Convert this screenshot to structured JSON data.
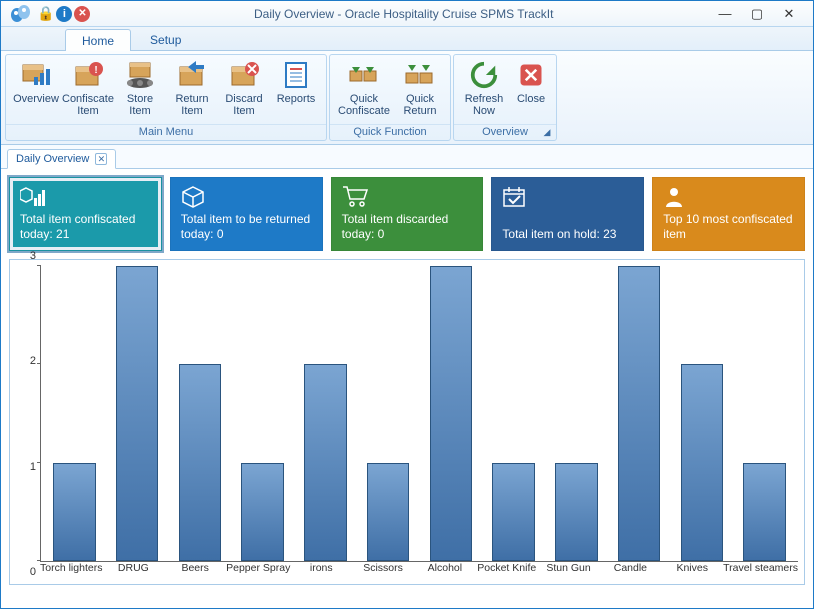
{
  "window": {
    "title": "Daily Overview - Oracle Hospitality Cruise SPMS TrackIt"
  },
  "tabs": {
    "home": "Home",
    "setup": "Setup"
  },
  "ribbon": {
    "main_menu": {
      "label": "Main Menu",
      "overview": "Overview",
      "confiscate_item": "Confiscate\nItem",
      "store_item": "Store\nItem",
      "return_item": "Return\nItem",
      "discard_item": "Discard\nItem",
      "reports": "Reports"
    },
    "quick_function": {
      "label": "Quick Function",
      "quick_confiscate": "Quick\nConfiscate",
      "quick_return": "Quick\nReturn"
    },
    "overview": {
      "label": "Overview",
      "refresh_now": "Refresh\nNow",
      "close": "Close"
    }
  },
  "doc_tab": {
    "label": "Daily Overview"
  },
  "tiles": {
    "confiscated": "Total item confiscated today: 21",
    "to_return": "Total item to be returned today: 0",
    "discarded": "Total item discarded today: 0",
    "on_hold": "Total item on hold: 23",
    "top10": "Top 10 most confiscated item"
  },
  "chart_data": {
    "type": "bar",
    "title": "",
    "xlabel": "",
    "ylabel": "",
    "ylim": [
      0,
      3
    ],
    "yticks": [
      0,
      1,
      2,
      3
    ],
    "categories": [
      "Torch lighters",
      "DRUG",
      "Beers",
      "Pepper Spray",
      "irons",
      "Scissors",
      "Alcohol",
      "Pocket Knife",
      "Stun Gun",
      "Candle",
      "Knives",
      "Travel steamers"
    ],
    "values": [
      1,
      3,
      2,
      1,
      2,
      1,
      3,
      1,
      1,
      3,
      2,
      1
    ]
  }
}
